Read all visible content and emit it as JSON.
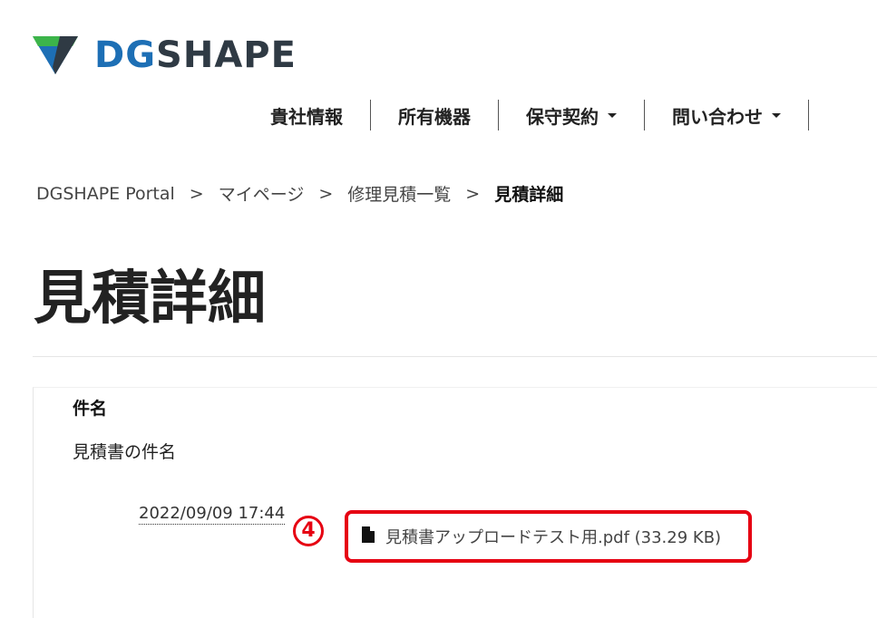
{
  "brand": {
    "logo_dg": "DG",
    "logo_shape": "SHAPE",
    "icon": "dgshape-logo-icon",
    "colors": {
      "blue": "#1d6fb5",
      "dark": "#2f3a44",
      "green": "#3cb44a"
    }
  },
  "nav": {
    "items": [
      {
        "label": "貴社情報",
        "dropdown": false
      },
      {
        "label": "所有機器",
        "dropdown": false
      },
      {
        "label": "保守契約",
        "dropdown": true
      },
      {
        "label": "問い合わせ",
        "dropdown": true
      }
    ]
  },
  "breadcrumb": {
    "items": [
      "DGSHAPE Portal",
      "マイページ",
      "修理見積一覧"
    ],
    "separator": ">",
    "current": "見積詳細"
  },
  "page": {
    "title": "見積詳細"
  },
  "detail": {
    "subject_label": "件名",
    "subject_value": "見積書の件名",
    "timestamp": "2022/09/09 17:44",
    "attachment": {
      "icon": "file-icon",
      "label": "見積書アップロードテスト用.pdf (33.29 KB)"
    }
  },
  "annotation": {
    "marker": "4",
    "color": "#e60012"
  }
}
